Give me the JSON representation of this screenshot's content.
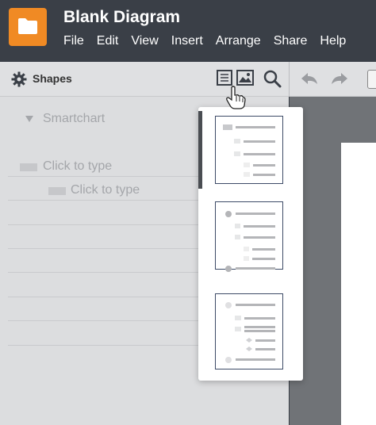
{
  "app": {
    "title": "Blank Diagram",
    "accent_color": "#f08a24",
    "icon": "folder-icon"
  },
  "menu": [
    "File",
    "Edit",
    "View",
    "Insert",
    "Arrange",
    "Share",
    "Help"
  ],
  "toolbar": {
    "shapes_label": "Shapes",
    "icons": [
      "gear-icon",
      "list-view-icon",
      "image-icon",
      "search-icon",
      "undo-icon",
      "redo-icon"
    ]
  },
  "panel": {
    "section_label": "Smartchart",
    "rows": [
      {
        "text": "Click to type"
      },
      {
        "text": "Click to type"
      }
    ]
  },
  "popup": {
    "templates": [
      "template-1",
      "template-2",
      "template-3"
    ],
    "selected": 0
  }
}
